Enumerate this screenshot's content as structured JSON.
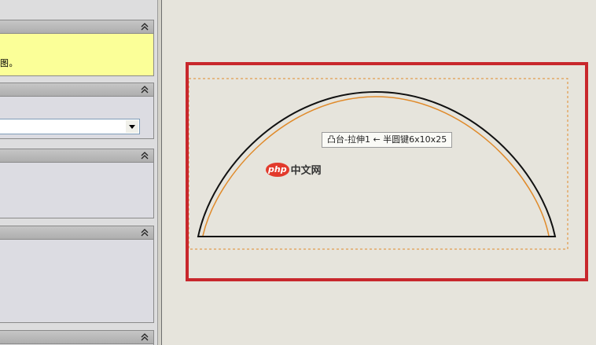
{
  "property_manager": {
    "message_group": {
      "text": "图。"
    },
    "selection_group": {
      "dropdown_value": ""
    }
  },
  "graphics": {
    "tooltip": "凸台-拉伸1 ← 半圆键6x10x25",
    "watermark": {
      "badge": "php",
      "text": "中文网"
    },
    "colors": {
      "highlight": "#c8272c",
      "preview": "#e08a2a",
      "sketch": "#000000"
    }
  }
}
